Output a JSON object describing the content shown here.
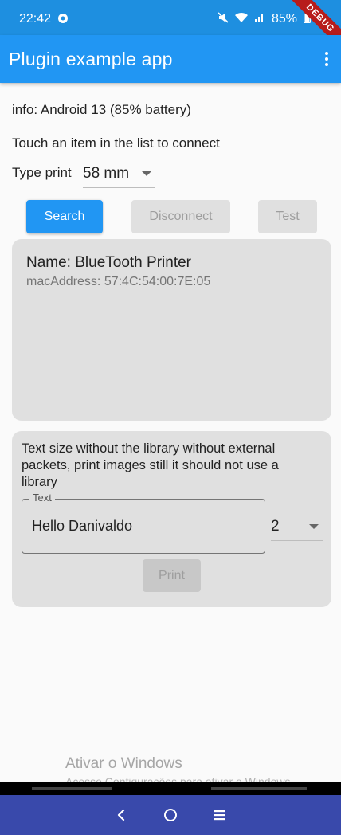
{
  "status_bar": {
    "time": "22:42",
    "battery": "85%",
    "icons": [
      "app-notification-icon",
      "mute-icon",
      "wifi-icon",
      "signal-icon",
      "battery-icon"
    ]
  },
  "debug_banner": "DEBUG",
  "app_bar": {
    "title": "Plugin example app"
  },
  "info_text": "info: Android 13 (85% battery)",
  "touch_text": "Touch an item in the list to connect",
  "type_print": {
    "label": "Type print",
    "selected": "58 mm"
  },
  "buttons": {
    "search": "Search",
    "disconnect": "Disconnect",
    "test": "Test"
  },
  "device": {
    "name": "Name: BlueTooth Printer",
    "mac": "macAddress: 57:4C:54:00:7E:05"
  },
  "print_card": {
    "description": "Text size without the library without external packets, print images still it should not use a library",
    "text_field_label": "Text",
    "text_field_value": "Hello Danivaldo",
    "size_selected": "2",
    "print_button": "Print"
  },
  "watermark": {
    "title": "Ativar o Windows",
    "subtitle": "Acesse Configurações para ativar o Windows."
  },
  "colors": {
    "primary": "#2196f3",
    "status_bar": "#1e8fe0",
    "nav_bar": "#3949ab",
    "card": "#e0e0e0"
  }
}
